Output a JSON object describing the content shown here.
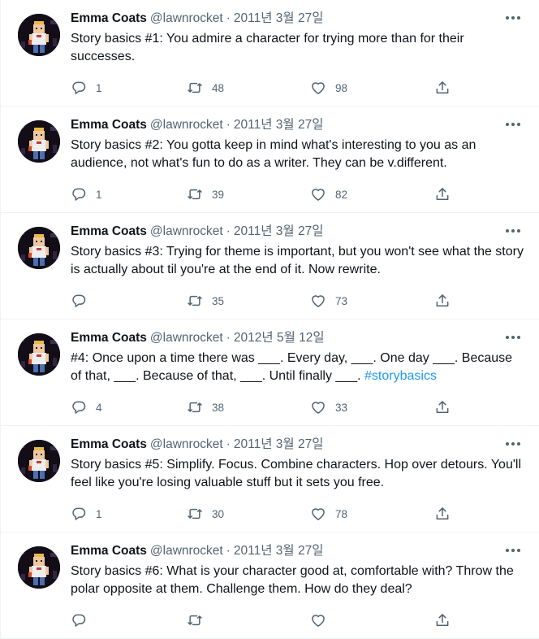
{
  "author": {
    "name": "Emma Coats",
    "handle": "@lawnrocket",
    "separator": "·"
  },
  "icons": {
    "more": "more-horizontal-icon",
    "reply": "reply-icon",
    "retweet": "retweet-icon",
    "like": "heart-icon",
    "share": "share-icon"
  },
  "colors": {
    "text": "#0f1419",
    "secondary": "#536471",
    "link": "#1d9bf0",
    "border": "#eff3f4"
  },
  "tweets": [
    {
      "date": "2011년 3월 27일",
      "text": "Story basics #1: You admire a character for trying more than for their successes.",
      "hashtag": "",
      "replies": "1",
      "retweets": "48",
      "likes": "98"
    },
    {
      "date": "2011년 3월 27일",
      "text": "Story basics #2: You gotta keep in mind what's interesting to you as an audience, not what's fun to do as a writer. They can be v.different.",
      "hashtag": "",
      "replies": "1",
      "retweets": "39",
      "likes": "82"
    },
    {
      "date": "2011년 3월 27일",
      "text": "Story basics #3: Trying for theme is important, but you won't see what the story is actually about til you're at the end of it. Now rewrite.",
      "hashtag": "",
      "replies": "",
      "retweets": "35",
      "likes": "73"
    },
    {
      "date": "2012년 5월 12일",
      "text": "#4: Once upon a time there was ___. Every day, ___. One day ___. Because of that, ___. Because of that, ___. Until finally ___. ",
      "hashtag": "#storybasics",
      "replies": "4",
      "retweets": "38",
      "likes": "33"
    },
    {
      "date": "2011년 3월 27일",
      "text": "Story basics #5: Simplify. Focus. Combine characters. Hop over detours. You'll feel like you're losing valuable stuff but it sets you free.",
      "hashtag": "",
      "replies": "1",
      "retweets": "30",
      "likes": "78"
    },
    {
      "date": "2011년 3월 27일",
      "text": "Story basics #6: What is your character good at, comfortable with? Throw the polar opposite at them. Challenge them. How do they deal?",
      "hashtag": "",
      "replies": "",
      "retweets": "",
      "likes": ""
    }
  ]
}
